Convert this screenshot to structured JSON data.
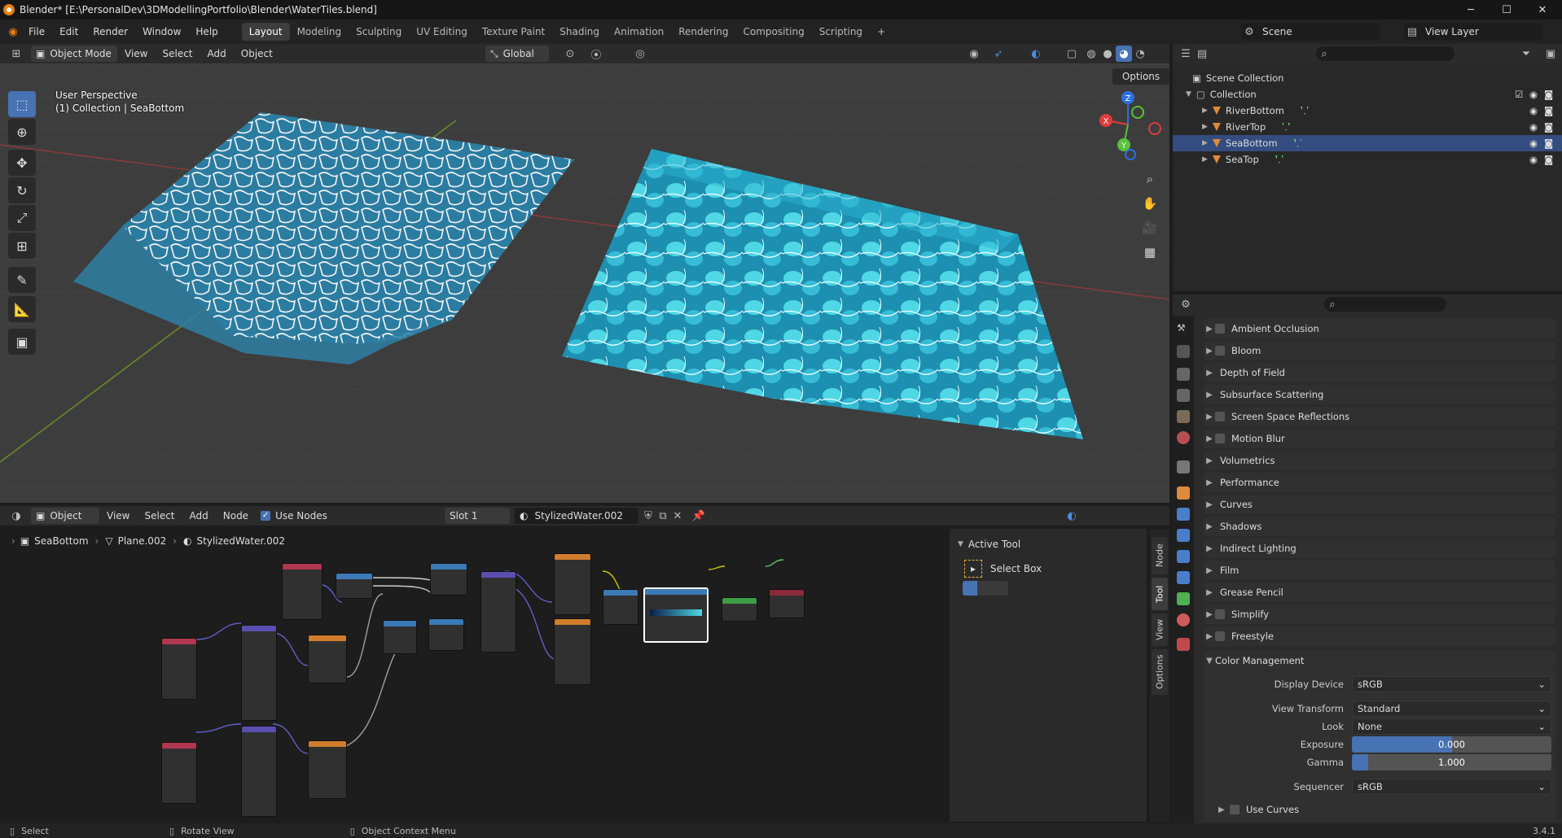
{
  "window": {
    "title": "Blender* [E:\\PersonalDev\\3DModellingPortfolio\\Blender\\WaterTiles.blend]",
    "minimize": "─",
    "maximize": "☐",
    "close": "✕"
  },
  "menu": {
    "items": [
      "File",
      "Edit",
      "Render",
      "Window",
      "Help"
    ],
    "workspaces": [
      "Layout",
      "Modeling",
      "Sculpting",
      "UV Editing",
      "Texture Paint",
      "Shading",
      "Animation",
      "Rendering",
      "Compositing",
      "Scripting"
    ],
    "active_workspace": "Layout",
    "add_workspace": "+",
    "scene": "Scene",
    "view_layer": "View Layer"
  },
  "viewport": {
    "mode": "Object Mode",
    "menus": [
      "View",
      "Select",
      "Add",
      "Object"
    ],
    "transform_orientation": "Global",
    "options": "Options",
    "overlay_line1": "User Perspective",
    "overlay_line2": "(1) Collection | SeaBottom",
    "gizmo_axes": {
      "x": "X",
      "y": "Y",
      "z": "Z"
    }
  },
  "outliner": {
    "scene_collection": "Scene Collection",
    "collection": "Collection",
    "objects": [
      "RiverBottom",
      "RiverTop",
      "SeaBottom",
      "SeaTop"
    ]
  },
  "properties": {
    "search_placeholder": "",
    "panels": [
      {
        "label": "Ambient Occlusion",
        "checkbox": true
      },
      {
        "label": "Bloom",
        "checkbox": true
      },
      {
        "label": "Depth of Field",
        "checkbox": false
      },
      {
        "label": "Subsurface Scattering",
        "checkbox": false
      },
      {
        "label": "Screen Space Reflections",
        "checkbox": true
      },
      {
        "label": "Motion Blur",
        "checkbox": true
      },
      {
        "label": "Volumetrics",
        "checkbox": false
      },
      {
        "label": "Performance",
        "checkbox": false
      },
      {
        "label": "Curves",
        "checkbox": false
      },
      {
        "label": "Shadows",
        "checkbox": false
      },
      {
        "label": "Indirect Lighting",
        "checkbox": false
      },
      {
        "label": "Film",
        "checkbox": false
      },
      {
        "label": "Grease Pencil",
        "checkbox": false
      },
      {
        "label": "Simplify",
        "checkbox": true
      },
      {
        "label": "Freestyle",
        "checkbox": true
      }
    ],
    "color_management": {
      "title": "Color Management",
      "display_device_label": "Display Device",
      "display_device": "sRGB",
      "view_transform_label": "View Transform",
      "view_transform": "Standard",
      "look_label": "Look",
      "look": "None",
      "exposure_label": "Exposure",
      "exposure": "0.000",
      "exposure_fill": 0.5,
      "gamma_label": "Gamma",
      "gamma": "1.000",
      "gamma_fill": 0.08,
      "sequencer_label": "Sequencer",
      "sequencer": "sRGB",
      "use_curves": "Use Curves"
    }
  },
  "node_editor": {
    "type": "Object",
    "menus": [
      "View",
      "Select",
      "Add",
      "Node"
    ],
    "use_nodes": "Use Nodes",
    "slot": "Slot 1",
    "material": "StylizedWater.002",
    "breadcrumb": [
      "SeaBottom",
      "Plane.002",
      "StylizedWater.002"
    ]
  },
  "sidebar": {
    "section": "Active Tool",
    "tool": "Select Box",
    "tabs": [
      "Node",
      "Tool",
      "View",
      "Options"
    ]
  },
  "statusbar": {
    "select": "Select",
    "rotate": "Rotate View",
    "context": "Object Context Menu",
    "version": "3.4.1"
  }
}
